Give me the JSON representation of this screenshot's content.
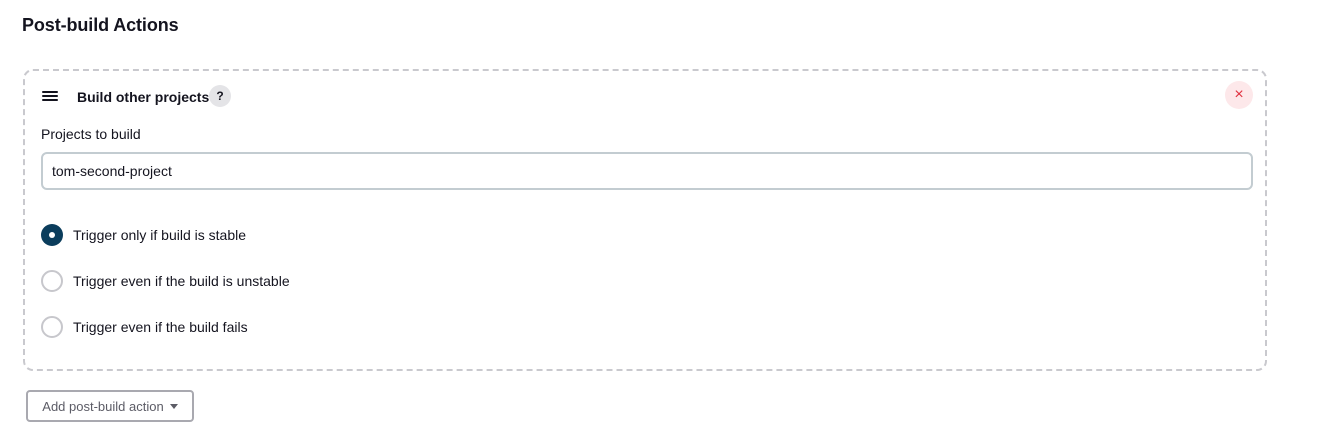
{
  "section": {
    "title": "Post-build Actions"
  },
  "action_card": {
    "title": "Build other projects",
    "help_label": "?",
    "close_label": "×",
    "projects_field": {
      "label": "Projects to build",
      "value": "tom-second-project"
    },
    "trigger_options": [
      {
        "label": "Trigger only if build is stable",
        "selected": true
      },
      {
        "label": "Trigger even if the build is unstable",
        "selected": false
      },
      {
        "label": "Trigger even if the build fails",
        "selected": false
      }
    ]
  },
  "add_button": {
    "label": "Add post-build action"
  },
  "colors": {
    "radio_selected": "#0b3d5c",
    "close_icon": "#e0303f",
    "close_background": "#fde8ea",
    "card_border": "#c9c9ce"
  },
  "icons": {
    "drag": "drag-handle-icon",
    "help": "help-icon",
    "close": "close-icon",
    "caret": "chevron-down-icon"
  }
}
